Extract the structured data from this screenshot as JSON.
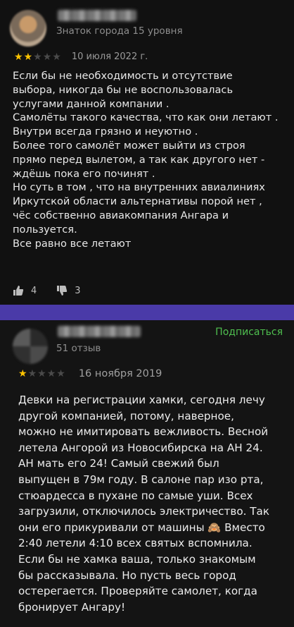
{
  "review1": {
    "author_level": "Знаток города 15 уровня",
    "rating": 2,
    "date": "10 июля 2022 г.",
    "lines": [
      "Если бы не необходимость и отсутствие",
      "выбора, никогда бы не воспользовалась",
      "услугами данной компании .",
      "Самолёты такого качества, что как они летают .",
      "Внутри всегда грязно и неуютно .",
      "Более того самолёт может выйти из строя",
      "прямо перед вылетом, а так как другого нет -",
      "ждёшь пока его починят .",
      "Но суть в том , что на внутренних авиалиниях",
      "Иркутской области альтернативы порой нет ,",
      "чёс собственно авиакомпания Ангара и",
      "пользуется.",
      "Все равно все летают"
    ],
    "likes": "4",
    "dislikes": "3"
  },
  "review2": {
    "reviews_count": "51 отзыв",
    "subscribe_label": "Подписаться",
    "rating": 1,
    "date": "16 ноября 2019",
    "lines": [
      "Девки на регистрации хамки, сегодня лечу",
      "другой компанией, потому, наверное,",
      "можно не имитировать вежливость. Весной",
      "летела Ангорой из Новосибирска на АН 24.",
      "АН мать его 24! Самый свежий был",
      "выпущен в 79м году. В салоне пар изо рта,",
      "стюардесса в пухане по самые уши. Всех",
      "загрузили, отключилось электричество. Так",
      "они его прикуривали от машины 🙈 Вместо",
      "2:40 летели 4:10 всех святых вспомнила.",
      "Если бы не хамка ваша, только знакомым",
      "бы рассказывала. Но пусть весь город",
      "остерегается. Проверяйте самолет, когда",
      "бронирует Ангару!"
    ]
  },
  "colors": {
    "star_on": "#ffc400",
    "star_off": "#4a4a4a",
    "divider": "#4a3aa8",
    "subscribe": "#4fbf4f"
  }
}
